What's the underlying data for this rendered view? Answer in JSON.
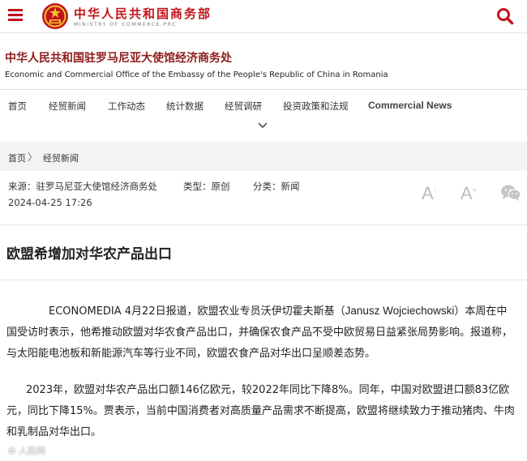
{
  "header": {
    "brand_cn": "中华人民共和国商务部",
    "brand_en": "MINISTRY OF COMMERCE.PRC",
    "accent_color": "#c0141c",
    "menu_icon": "menu-icon",
    "search_icon": "search-icon"
  },
  "office": {
    "name_cn": "中华人民共和国驻罗马尼亚大使馆经济商务处",
    "name_en": "Economic and Commercial Office of the Embassy of the People's Republic of China in Romania"
  },
  "nav": {
    "items": [
      "首页",
      "经贸新闻",
      "工作动态",
      "统计数据",
      "经贸调研",
      "投资政策和法规",
      "Commercial News"
    ],
    "expand_icon": "chevron-down-icon"
  },
  "breadcrumb": {
    "home": "首页",
    "separator": "〉",
    "current": "经贸新闻"
  },
  "meta": {
    "source": "来源：驻罗马尼亚大使馆经济商务处",
    "type": "类型：原创",
    "category": "分类：新闻",
    "datetime": "2024-04-25 17:26",
    "font_decrease": "A",
    "font_increase": "A",
    "share_icon": "wechat-icon"
  },
  "article": {
    "title": "欧盟希增加对华农产品出口",
    "p1_a": "ECONOMEDIA 4月22日报道，欧盟农业专员沃伊切霍夫斯基（",
    "p1_name": "Janusz Wojciechowski",
    "p1_b": "）本周在中国受访时表示，他希推动欧盟对华农食产品出口，并确保农食产品不受中欧贸易日益紧张局势影响。报道称，与太阳能电池板和新能源汽车等行业不同，欧盟农食产品对华出口呈顺差态势。",
    "p2": "2023年，欧盟对华农产品出口额146亿欧元，较2022年同比下降8%。同年，中国对欧盟进口额83亿欧元，同比下降15%。贾表示，当前中国消费者对高质量产品需求不断提高，欧盟将继续致力于推动猪肉、牛肉和乳制品对华出口。"
  },
  "watermark": "✿ 人民网"
}
